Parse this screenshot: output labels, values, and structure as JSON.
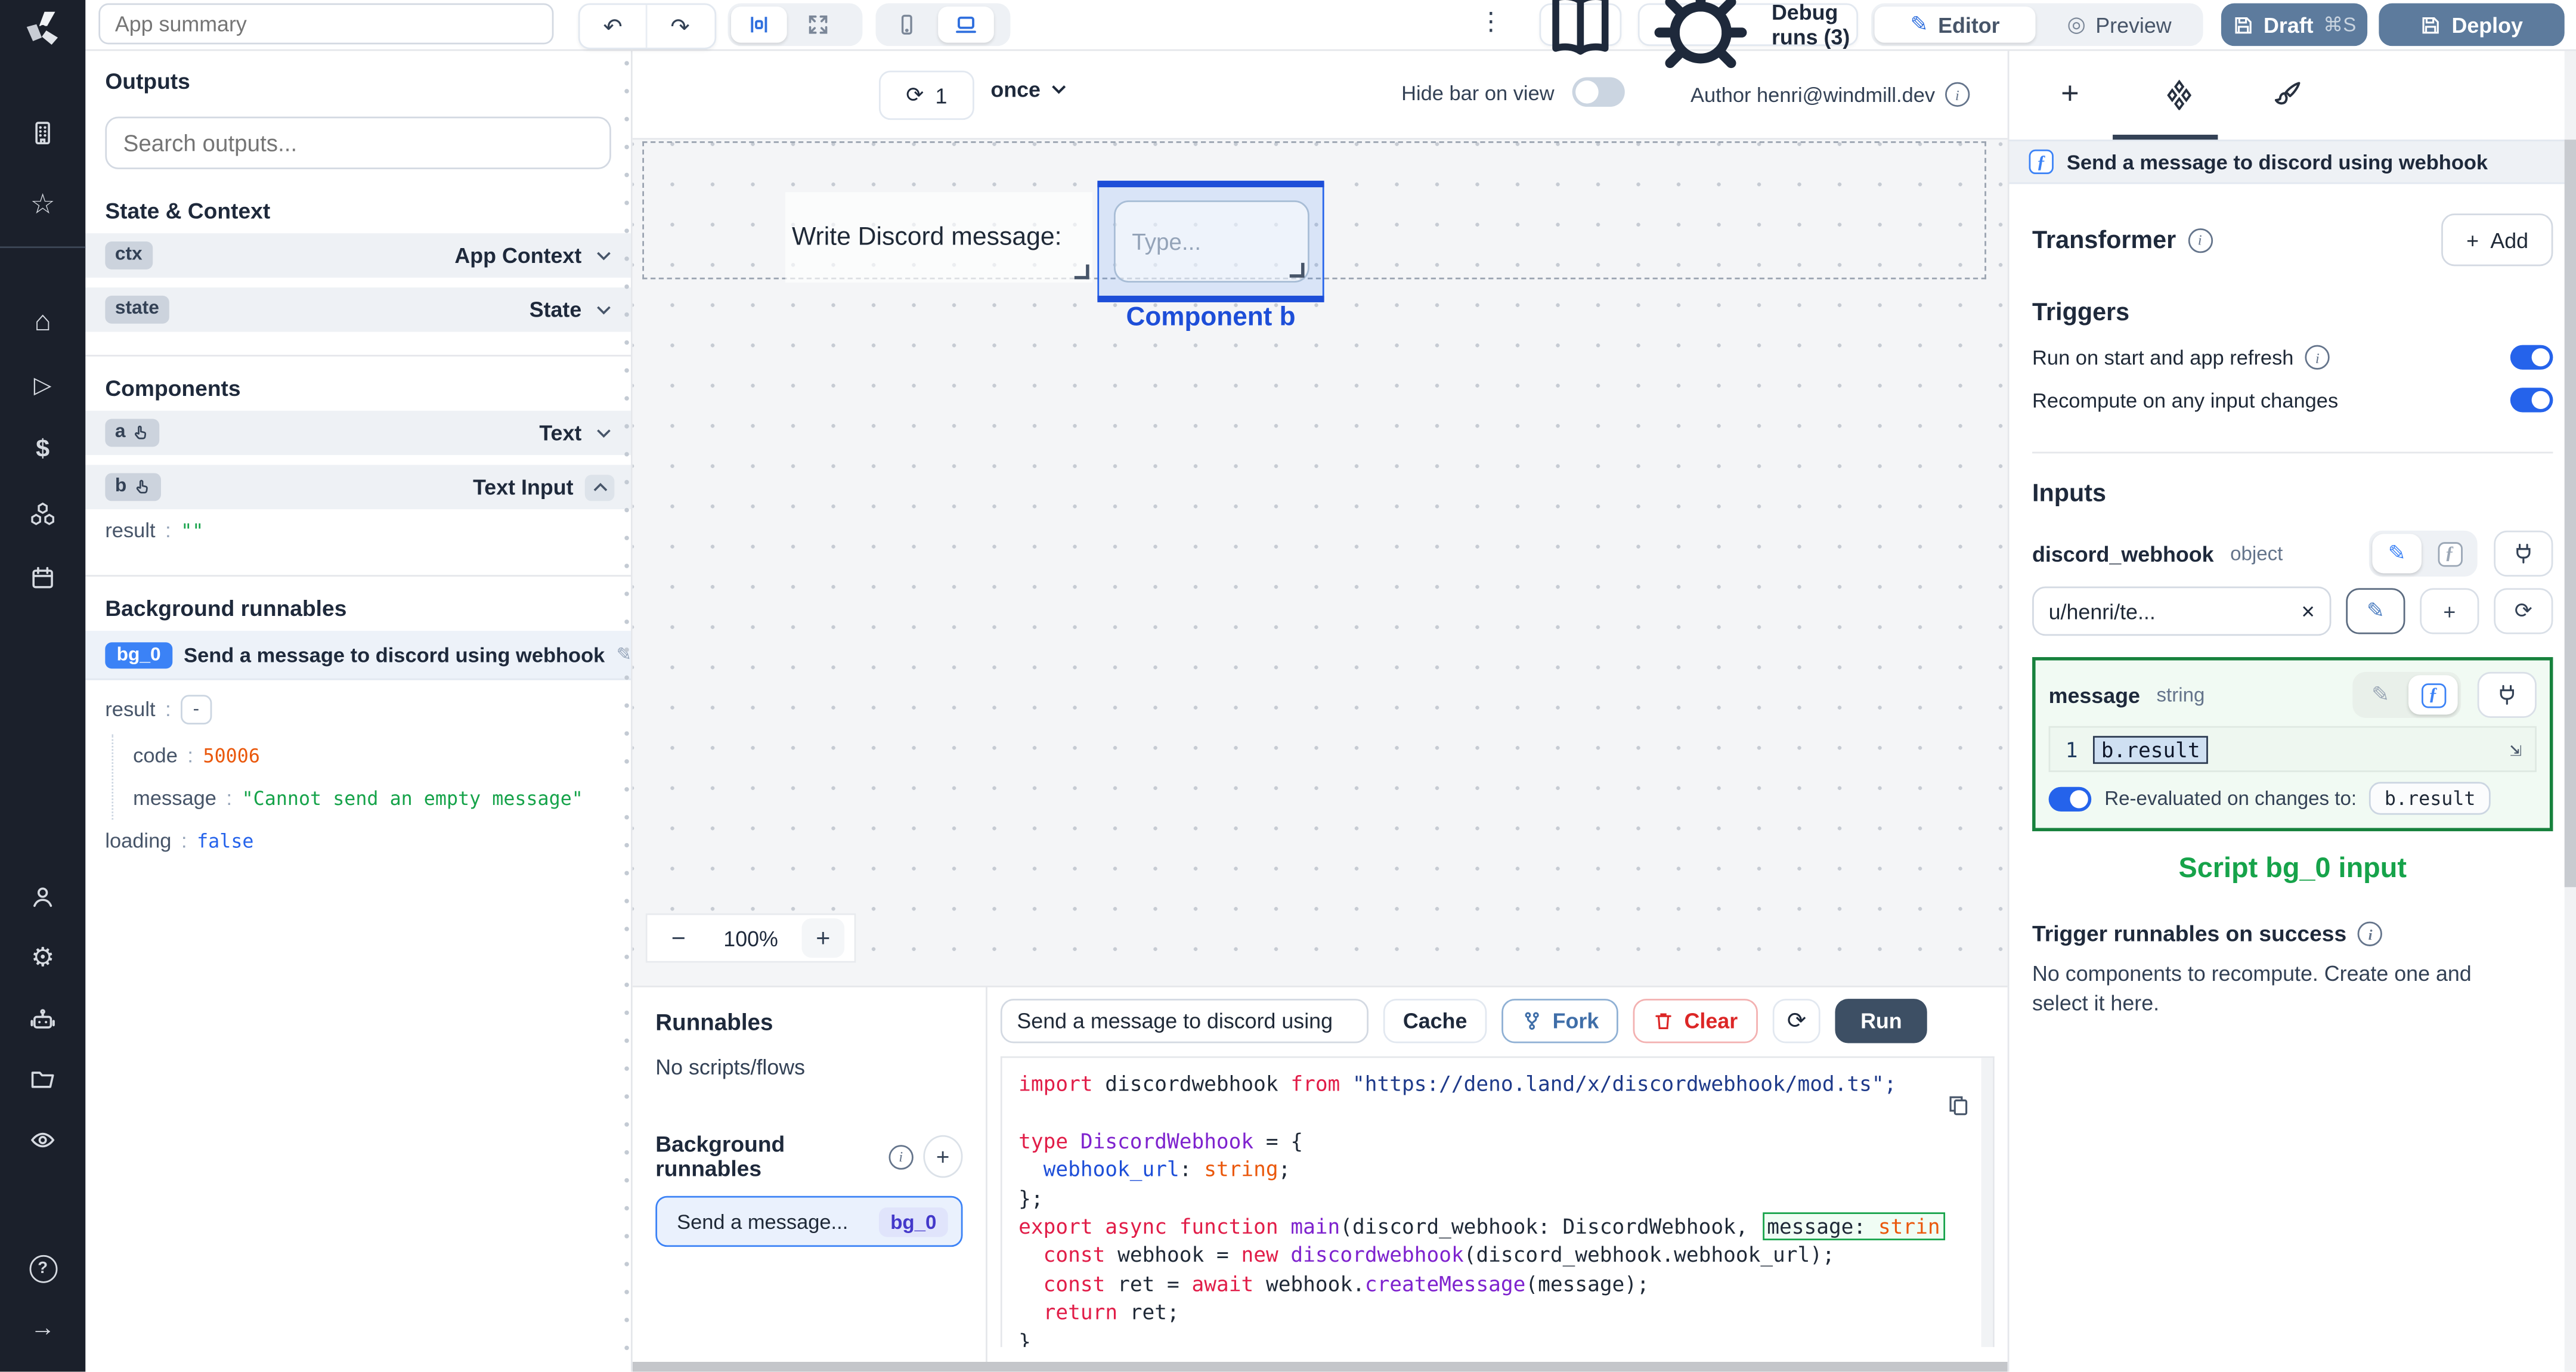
{
  "colors": {
    "accent_blue": "#2563eb",
    "selection_blue": "#1d4ed8",
    "highlight_green": "#16a34a",
    "error_orange": "#ea580c",
    "slate_button": "#5d7b9d",
    "rail_bg": "#1b202b"
  },
  "glyphs": {
    "undo": "↶",
    "redo": "↷",
    "kebab": "⋮",
    "close": "×",
    "refresh": "⟳",
    "pencil": "✎",
    "plus": "+",
    "minus": "−",
    "chevron_down": "∨",
    "chevron_up": "∧",
    "star": "☆",
    "home": "⌂",
    "play": "▷",
    "dollar": "$",
    "gear": "⚙",
    "help": "?",
    "arrow_right": "→",
    "preview": "◎",
    "expand": "⇲",
    "fn": "ƒ",
    "info": "i"
  },
  "topbar": {
    "app_summary_placeholder": "App summary",
    "debug_runs_label": "Debug runs (3)",
    "editor_label": "Editor",
    "preview_label": "Preview",
    "draft_label": "Draft",
    "draft_shortcut": "⌘S",
    "deploy_label": "Deploy"
  },
  "outputs_panel": {
    "title": "Outputs",
    "search_placeholder": "Search outputs...",
    "state_context_title": "State & Context",
    "ctx_badge": "ctx",
    "ctx_type": "App Context",
    "state_badge": "state",
    "state_type": "State",
    "components_title": "Components",
    "a_badge": "a",
    "a_type": "Text",
    "b_badge": "b",
    "b_type": "Text Input",
    "b_result_key": "result",
    "b_result_value": "\"\"",
    "background_title": "Background runnables",
    "bg0_badge": "bg_0",
    "bg0_label": "Send a message to discord using webhook",
    "result_key": "result",
    "result_value": "-",
    "code_key": "code",
    "code_value": "50006",
    "message_key": "message",
    "message_value": "\"Cannot send an empty message\"",
    "loading_key": "loading",
    "loading_value": "false"
  },
  "canvas": {
    "runs_count": "1",
    "frequency": "once",
    "hide_bar_label": "Hide bar on view",
    "author_label": "Author henri@windmill.dev",
    "text_component": "Write Discord message:",
    "input_placeholder": "Type...",
    "selected_component_label": "Component b",
    "zoom_level": "100%"
  },
  "runnables_panel": {
    "title": "Runnables",
    "empty_label": "No scripts/flows",
    "background_title": "Background runnables",
    "item_label": "Send a message...",
    "item_badge": "bg_0"
  },
  "code_editor": {
    "name_value": "Send a message to discord using",
    "cache_label": "Cache",
    "fork_label": "Fork",
    "clear_label": "Clear",
    "run_label": "Run",
    "lines": [
      [
        {
          "c": "kw",
          "t": "import"
        },
        {
          "c": "df",
          "t": " discordwebhook "
        },
        {
          "c": "kw",
          "t": "from"
        },
        {
          "c": "str",
          "t": " \"https://deno.land/x/discordwebhook/mod.ts\";"
        }
      ],
      [],
      [
        {
          "c": "kw",
          "t": "type"
        },
        {
          "c": "ty",
          "t": " DiscordWebhook"
        },
        {
          "c": "df",
          "t": " = {"
        }
      ],
      [
        {
          "c": "pr",
          "t": "  webhook_url"
        },
        {
          "c": "df",
          "t": ": "
        },
        {
          "c": "pm",
          "t": "string"
        },
        {
          "c": "df",
          "t": ";"
        }
      ],
      [
        {
          "c": "df",
          "t": "};"
        }
      ],
      [
        {
          "c": "kw",
          "t": "export async function"
        },
        {
          "c": "fn",
          "t": " main"
        },
        {
          "c": "df",
          "t": "(discord_webhook: DiscordWebhook, "
        },
        {
          "hl": [
            {
              "c": "df",
              "t": "message: "
            },
            {
              "c": "pm",
              "t": "strin"
            }
          ]
        }
      ],
      [
        {
          "c": "df",
          "t": "  "
        },
        {
          "c": "kw",
          "t": "const"
        },
        {
          "c": "df",
          "t": " webhook = "
        },
        {
          "c": "kw",
          "t": "new"
        },
        {
          "c": "fn",
          "t": " discordwebhook"
        },
        {
          "c": "df",
          "t": "(discord_webhook.webhook_url);"
        }
      ],
      [
        {
          "c": "df",
          "t": "  "
        },
        {
          "c": "kw",
          "t": "const"
        },
        {
          "c": "df",
          "t": " ret = "
        },
        {
          "c": "kw",
          "t": "await"
        },
        {
          "c": "df",
          "t": " webhook."
        },
        {
          "c": "fn",
          "t": "createMessage"
        },
        {
          "c": "df",
          "t": "(message);"
        }
      ],
      [
        {
          "c": "df",
          "t": "  "
        },
        {
          "c": "kw",
          "t": "return"
        },
        {
          "c": "df",
          "t": " ret;"
        }
      ],
      [
        {
          "c": "df",
          "t": "}"
        }
      ]
    ]
  },
  "right_panel": {
    "header": "Send a message to discord using webhook",
    "transformer_title": "Transformer",
    "add_label": "Add",
    "triggers_title": "Triggers",
    "trigger_rows": [
      "Run on start and app refresh",
      "Recompute on any input changes"
    ],
    "inputs_title": "Inputs",
    "dw_name": "discord_webhook",
    "dw_type": "object",
    "dw_value": "u/henri/te...",
    "msg_name": "message",
    "msg_type": "string",
    "msg_line_number": "1",
    "msg_value": "b.result",
    "reeval_label": "Re-evaluated on changes to:",
    "reeval_value": "b.result",
    "script_input_label": "Script bg_0 input",
    "trigger_success_title": "Trigger runnables on success",
    "trigger_success_empty": "No components to recompute. Create one and select it here."
  }
}
